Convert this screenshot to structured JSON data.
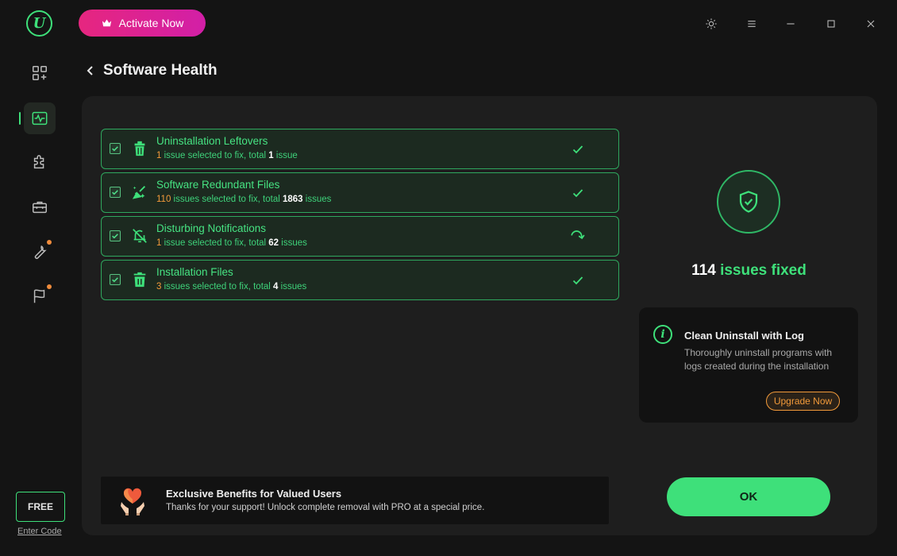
{
  "app": {
    "logo_letter": "U",
    "accent_color": "#3ee07a",
    "activate_label": "Activate Now"
  },
  "sidebar": {
    "items": [
      {
        "name": "dashboard",
        "icon": "apps-add-icon"
      },
      {
        "name": "software-health",
        "icon": "pulse-monitor-icon",
        "active": true
      },
      {
        "name": "plugins",
        "icon": "puzzle-icon"
      },
      {
        "name": "toolbox",
        "icon": "toolbox-icon"
      },
      {
        "name": "tools",
        "icon": "wrench-icon",
        "badge": true
      },
      {
        "name": "report",
        "icon": "flag-icon",
        "badge": true
      }
    ],
    "free_label": "FREE",
    "enter_code_label": "Enter Code"
  },
  "header": {
    "title": "Software Health"
  },
  "issues": [
    {
      "name": "Uninstallation Leftovers",
      "selected": "1",
      "word1": " issue selected to fix, total ",
      "total": "1",
      "word2": " issue",
      "icon": "broom-bin-icon",
      "status": "check"
    },
    {
      "name": "Software Redundant Files",
      "selected": "110",
      "word1": " issues selected to fix, total ",
      "total": "1863",
      "word2": " issues",
      "icon": "sweep-sparkle-icon",
      "status": "check"
    },
    {
      "name": "Disturbing Notifications",
      "selected": "1",
      "word1": " issue selected to fix, total ",
      "total": "62",
      "word2": " issues",
      "icon": "bell-off-icon",
      "status": "processing"
    },
    {
      "name": "Installation Files",
      "selected": "3",
      "word1": " issues selected to fix, total ",
      "total": "4",
      "word2": " issues",
      "icon": "trash-icon",
      "status": "check"
    }
  ],
  "result": {
    "count": "114",
    "label": " issues fixed"
  },
  "tip": {
    "title": "Clean Uninstall with Log",
    "description": "Thoroughly uninstall programs with logs created during the installation",
    "button": "Upgrade Now"
  },
  "banner": {
    "title": "Exclusive Benefits for Valued Users",
    "description": "Thanks for your support! Unlock complete removal with PRO at a special price."
  },
  "ok_label": "OK"
}
